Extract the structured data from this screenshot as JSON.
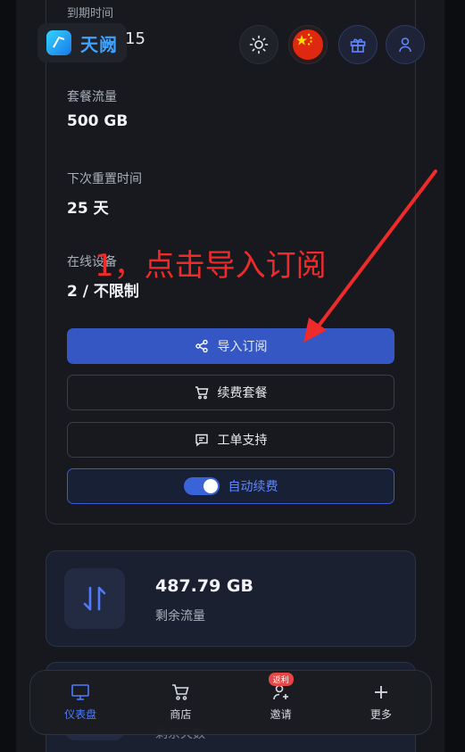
{
  "header": {
    "brand": "天阙",
    "partial_top_text": "到期时间",
    "partial_date": "15"
  },
  "info": {
    "plan_traffic_label": "套餐流量",
    "plan_traffic_value": "500 GB",
    "reset_label": "下次重置时间",
    "reset_value": "25 天",
    "devices_label": "在线设备",
    "devices_value": "2 / 不限制"
  },
  "annotation": "1，点击导入订阅",
  "actions": {
    "import_label": "导入订阅",
    "renew_label": "续费套餐",
    "ticket_label": "工单支持",
    "auto_renew_label": "自动续费",
    "auto_renew_on": true
  },
  "traffic": {
    "value": "487.79 GB",
    "label": "剩余流量"
  },
  "next_card": {
    "label": "剩余天数"
  },
  "nav": {
    "items": [
      {
        "label": "仪表盘",
        "icon": "monitor-icon"
      },
      {
        "label": "商店",
        "icon": "cart-icon"
      },
      {
        "label": "邀请",
        "icon": "user-plus-icon",
        "badge": "返利"
      },
      {
        "label": "更多",
        "icon": "plus-icon"
      }
    ]
  },
  "colors": {
    "primary": "#3457c4",
    "accent_blue": "#4f7bff",
    "annotation_red": "#ee2a2a"
  }
}
